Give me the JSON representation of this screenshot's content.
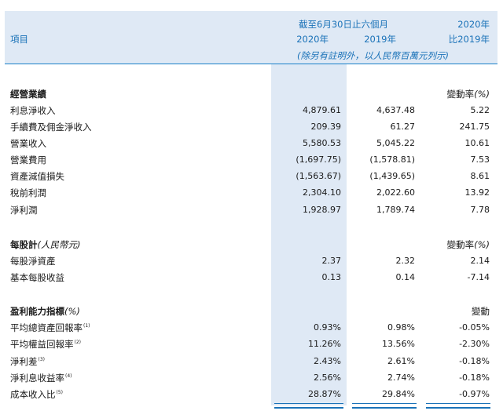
{
  "header": {
    "item_label": "項目",
    "period_label": "截至6月30日止六個月",
    "col_2020": "2020年",
    "col_2019": "2019年",
    "change_top": "2020年",
    "change_bottom": "比2019年",
    "unit_note": "(除另有註明外，以人民幣百萬元列示)"
  },
  "sections": [
    {
      "title": "經營業績",
      "title_suffix": "",
      "change_label": "變動率",
      "change_unit": "(%)",
      "rows": [
        {
          "label": "利息淨收入",
          "note": "",
          "v2020": "4,879.61",
          "v2019": "4,637.48",
          "change": "5.22"
        },
        {
          "label": "手續費及佣金淨收入",
          "note": "",
          "v2020": "209.39",
          "v2019": "61.27",
          "change": "241.75"
        },
        {
          "label": "營業收入",
          "note": "",
          "v2020": "5,580.53",
          "v2019": "5,045.22",
          "change": "10.61"
        },
        {
          "label": "營業費用",
          "note": "",
          "v2020": "(1,697.75)",
          "v2019": "(1,578.81)",
          "change": "7.53"
        },
        {
          "label": "資產減值損失",
          "note": "",
          "v2020": "(1,563.67)",
          "v2019": "(1,439.65)",
          "change": "8.61"
        },
        {
          "label": "稅前利潤",
          "note": "",
          "v2020": "2,304.10",
          "v2019": "2,022.60",
          "change": "13.92"
        },
        {
          "label": "淨利潤",
          "note": "",
          "v2020": "1,928.97",
          "v2019": "1,789.74",
          "change": "7.78"
        }
      ]
    },
    {
      "title": "每股計",
      "title_suffix": "(人民幣元)",
      "change_label": "變動率",
      "change_unit": "(%)",
      "rows": [
        {
          "label": "每股淨資產",
          "note": "",
          "v2020": "2.37",
          "v2019": "2.32",
          "change": "2.14"
        },
        {
          "label": "基本每股收益",
          "note": "",
          "v2020": "0.13",
          "v2019": "0.14",
          "change": "-7.14"
        }
      ]
    },
    {
      "title": "盈利能力指標",
      "title_suffix": "(%)",
      "change_label": "變動",
      "change_unit": "",
      "rows": [
        {
          "label": "平均總資產回報率",
          "note": "(1)",
          "v2020": "0.93%",
          "v2019": "0.98%",
          "change": "-0.05%"
        },
        {
          "label": "平均權益回報率",
          "note": "(2)",
          "v2020": "11.26%",
          "v2019": "13.56%",
          "change": "-2.30%"
        },
        {
          "label": "淨利差",
          "note": "(3)",
          "v2020": "2.43%",
          "v2019": "2.61%",
          "change": "-0.18%"
        },
        {
          "label": "淨利息收益率",
          "note": "(4)",
          "v2020": "2.56%",
          "v2019": "2.74%",
          "change": "-0.18%"
        },
        {
          "label": "成本收入比",
          "note": "(5)",
          "v2020": "28.87%",
          "v2019": "29.84%",
          "change": "-0.97%"
        }
      ]
    }
  ]
}
